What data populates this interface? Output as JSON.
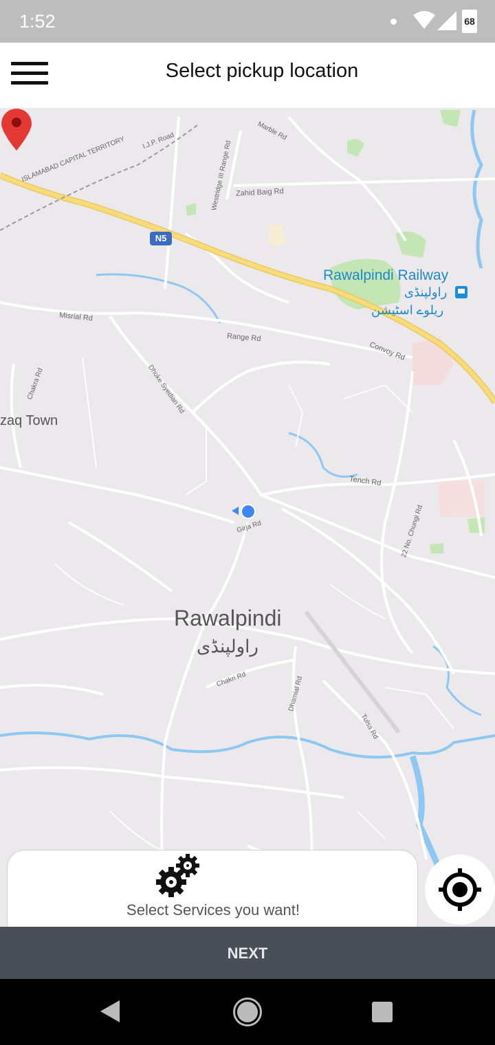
{
  "status_bar": {
    "time": "1:52",
    "battery": "68",
    "icons": [
      "notification-dot-icon",
      "wifi-icon",
      "signal-icon",
      "battery-icon"
    ]
  },
  "app_bar": {
    "menu_icon": "hamburger-menu-icon",
    "title": "Select pickup location"
  },
  "map": {
    "labels": {
      "islamabad": "ISLAMABAD CAPITAL TERRITORY",
      "ijp_road": "I.J.P. Road",
      "westridge": "Westridge III Range Rd",
      "marble": "Marble Rd",
      "zahid": "Zahid Baig Rd",
      "n5": "N5",
      "railway_en": "Rawalpindi Railway",
      "railway_ur1": "راولپنڈی",
      "railway_ur2": "ریلوے اسٹیشن",
      "misrial": "Misrial Rd",
      "range": "Range Rd",
      "convoy": "Convoy Rd",
      "chakra": "Chakra Rd",
      "dhoke": "Dhoke Syedian Rd",
      "zaq_town": "zaq Town",
      "tench": "Tench Rd",
      "girja": "Girja Rd",
      "chungi": "22 No. Chungi Rd",
      "city_en": "Rawalpindi",
      "city_ur": "راولپنڈی",
      "chakri": "Chakri Rd",
      "dhamial": "Dhamial Rd",
      "tulsa": "Tulsa Rd"
    },
    "colors": {
      "land": "#ece9ec",
      "road": "#ffffff",
      "highway": "#f6d86b",
      "water": "#8ec7f1",
      "park": "#c4e6b5",
      "pin": "#e53935",
      "my_location": "#4285f4"
    }
  },
  "services_card": {
    "icon": "gears-icon",
    "text": "Select Services you want!"
  },
  "locate_button": {
    "icon": "crosshair-location-icon"
  },
  "next_button": {
    "label": "NEXT"
  },
  "nav_bar": {
    "icons": [
      "back-icon",
      "home-icon",
      "recent-apps-icon"
    ]
  }
}
